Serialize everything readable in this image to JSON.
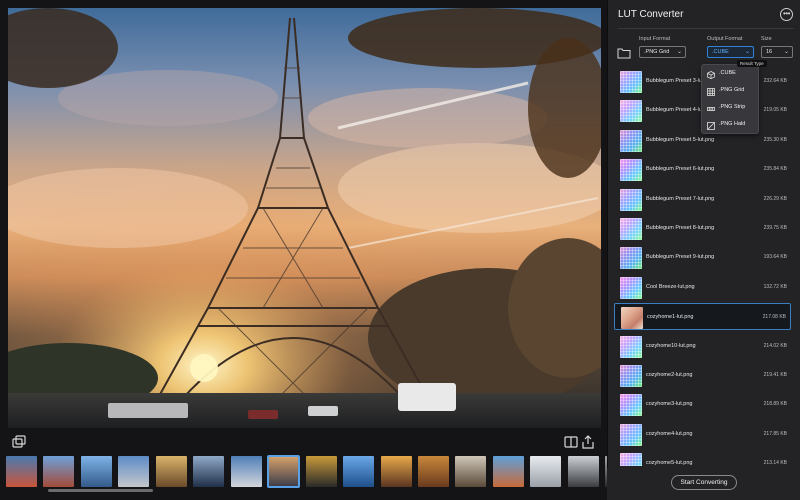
{
  "app": {
    "title": "LUT Converter",
    "more_label": "•••"
  },
  "controls": {
    "input_format_label": "Input Format",
    "input_format_value": ".PNG Grid",
    "output_format_label": "Output Format",
    "output_format_value": ".CUBE",
    "size_label": "Size",
    "size_value": "16",
    "tooltip": "Result Type"
  },
  "output_options": [
    {
      "label": ".CUBE",
      "icon": "cube-icon"
    },
    {
      "label": ".PNG Grid",
      "icon": "grid-icon"
    },
    {
      "label": ".PNG Strip",
      "icon": "strip-icon"
    },
    {
      "label": ".PNG Hald",
      "icon": "hald-icon"
    }
  ],
  "files": [
    {
      "name": "Bubblegum Preset 3-lut.png",
      "size": "232.64 KB",
      "selected": false
    },
    {
      "name": "Bubblegum Preset 4-lut.png",
      "size": "219.05 KB",
      "selected": false
    },
    {
      "name": "Bubblegum Preset 5-lut.png",
      "size": "235.30 KB",
      "selected": false
    },
    {
      "name": "Bubblegum Preset 6-lut.png",
      "size": "235.84 KB",
      "selected": false
    },
    {
      "name": "Bubblegum Preset 7-lut.png",
      "size": "226.29 KB",
      "selected": false
    },
    {
      "name": "Bubblegum Preset 8-lut.png",
      "size": "239.75 KB",
      "selected": false
    },
    {
      "name": "Bubblegum Preset 9-lut.png",
      "size": "193.64 KB",
      "selected": false
    },
    {
      "name": "Cool Breeze-lut.png",
      "size": "132.72 KB",
      "selected": false
    },
    {
      "name": "cozyhome1-lut.png",
      "size": "217.08 KB",
      "selected": true
    },
    {
      "name": "cozyhome10-lut.png",
      "size": "214.02 KB",
      "selected": false
    },
    {
      "name": "cozyhome2-lut.png",
      "size": "219.41 KB",
      "selected": false
    },
    {
      "name": "cozyhome3-lut.png",
      "size": "218.89 KB",
      "selected": false
    },
    {
      "name": "cozyhome4-lut.png",
      "size": "217.85 KB",
      "selected": false
    },
    {
      "name": "cozyhome5-lut.png",
      "size": "213.14 KB",
      "selected": false
    }
  ],
  "actions": {
    "convert_label": "Start Converting"
  },
  "colors": {
    "accent": "#2f82d8",
    "selection": "#3a7fc4",
    "background": "#232326"
  }
}
